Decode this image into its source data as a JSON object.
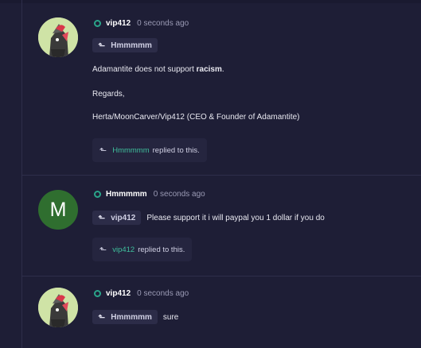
{
  "posts": [
    {
      "username": "vip412",
      "time": "0 seconds ago",
      "reply_to": "Hmmmmm",
      "line1_pre": "Adamantite does not support ",
      "line1_bold": "racism",
      "line1_post": ".",
      "line2": "Regards,",
      "line3": "Herta/MoonCarver/Vip412 (CEO & Founder of Adamantite)",
      "replied_by": "Hmmmmm",
      "replied_suffix": "replied to this."
    },
    {
      "username": "Hmmmmm",
      "avatar_letter": "M",
      "time": "0 seconds ago",
      "reply_to": "vip412",
      "message": "Please support it i will paypal you 1 dollar if you do",
      "replied_by": "vip412",
      "replied_suffix": "replied to this."
    },
    {
      "username": "vip412",
      "time": "0 seconds ago",
      "reply_to": "Hmmmmm",
      "message": "sure"
    }
  ],
  "colors": {
    "background": "#1e1e36",
    "online": "#2aa58a",
    "accent_name": "#3fbf9c",
    "avatar_green": "#2f6e2f"
  },
  "icons": {
    "reply": "reply-arrow-icon",
    "status": "online-status-icon"
  }
}
